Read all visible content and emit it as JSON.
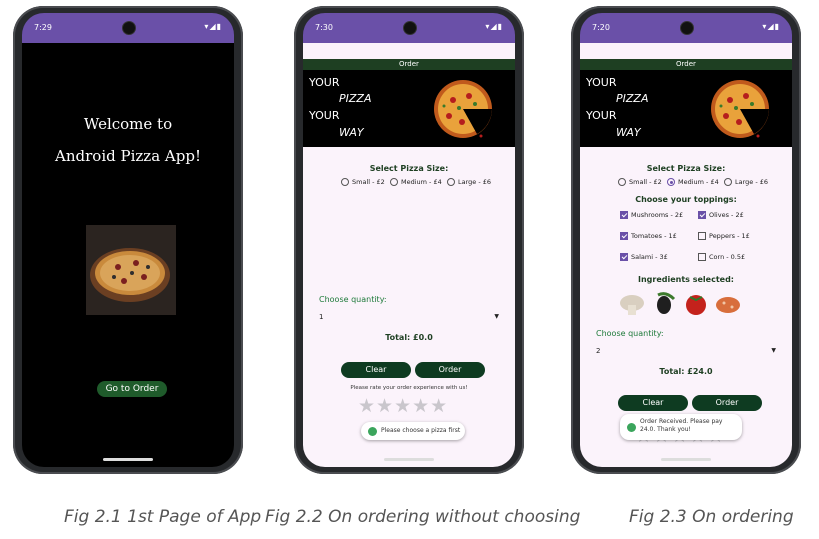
{
  "phone1": {
    "time": "7:29",
    "welcome_line1": "Welcome to",
    "welcome_line2": "Android Pizza App!",
    "go_button": "Go to Order"
  },
  "phone2": {
    "time": "7:30",
    "order_title": "Order",
    "banner": [
      "YOUR",
      "PIZZA",
      "YOUR",
      "WAY"
    ],
    "size_heading": "Select Pizza Size:",
    "sizes": [
      "Small - £2",
      "Medium - £4",
      "Large - £6"
    ],
    "quantity_label": "Choose quantity:",
    "quantity_value": "1",
    "total": "Total: £0.0",
    "clear_button": "Clear",
    "order_button": "Order",
    "rate_text": "Please rate your order experience with us!",
    "toast": "Please choose a pizza first"
  },
  "phone3": {
    "time": "7:20",
    "order_title": "Order",
    "banner": [
      "YOUR",
      "PIZZA",
      "YOUR",
      "WAY"
    ],
    "size_heading": "Select Pizza Size:",
    "sizes": [
      "Small - £2",
      "Medium - £4",
      "Large - £6"
    ],
    "selected_size": "Medium - £4",
    "toppings_heading": "Choose your toppings:",
    "toppings": [
      {
        "label": "Mushrooms - 2£",
        "checked": true
      },
      {
        "label": "Olives - 2£",
        "checked": true
      },
      {
        "label": "Tomatoes - 1£",
        "checked": true
      },
      {
        "label": "Peppers - 1£",
        "checked": false
      },
      {
        "label": "Salami - 3£",
        "checked": true
      },
      {
        "label": "Corn - 0.5£",
        "checked": false
      }
    ],
    "ingredients_heading": "Ingredients selected:",
    "quantity_label": "Choose quantity:",
    "quantity_value": "2",
    "total": "Total: £24.0",
    "clear_button": "Clear",
    "order_button": "Order",
    "toast": "Order Received. Please pay 24.0. Thank you!"
  },
  "captions": [
    "Fig 2.1 1st Page of App",
    "Fig 2.2 On ordering without choosing",
    "Fig 2.3 On ordering"
  ],
  "colors": {
    "statusbar": "#6a50a8",
    "dark_green": "#0e3b21",
    "accent_green": "#1f5b2b"
  }
}
